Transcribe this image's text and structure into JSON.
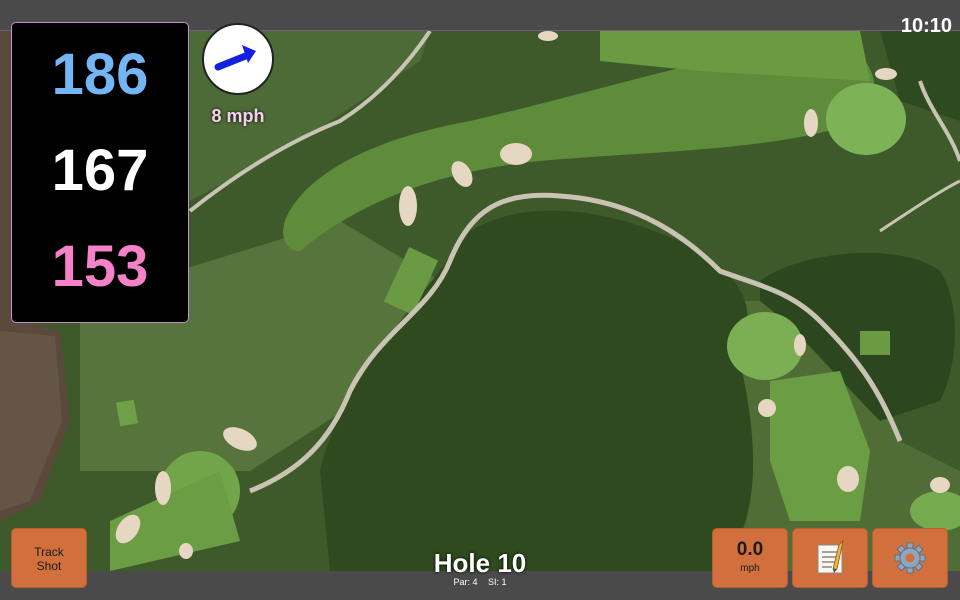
{
  "status": {
    "time": "10:10"
  },
  "distances": {
    "back": "186",
    "middle": "167",
    "front": "153"
  },
  "colors": {
    "back": "#74b6f5",
    "middle": "#ffffff",
    "front": "#f582c8",
    "button": "#d2703d"
  },
  "wind": {
    "speed": "8 mph",
    "arrow_icon": "wind-arrow-icon"
  },
  "hole": {
    "title": "Hole 10",
    "par": "Par: 4",
    "si": "SI: 1"
  },
  "buttons": {
    "track_line1": "Track",
    "track_line2": "Shot",
    "speed_value": "0.0",
    "speed_unit": "mph",
    "notes_icon": "memo-icon",
    "settings_icon": "gear-icon"
  }
}
